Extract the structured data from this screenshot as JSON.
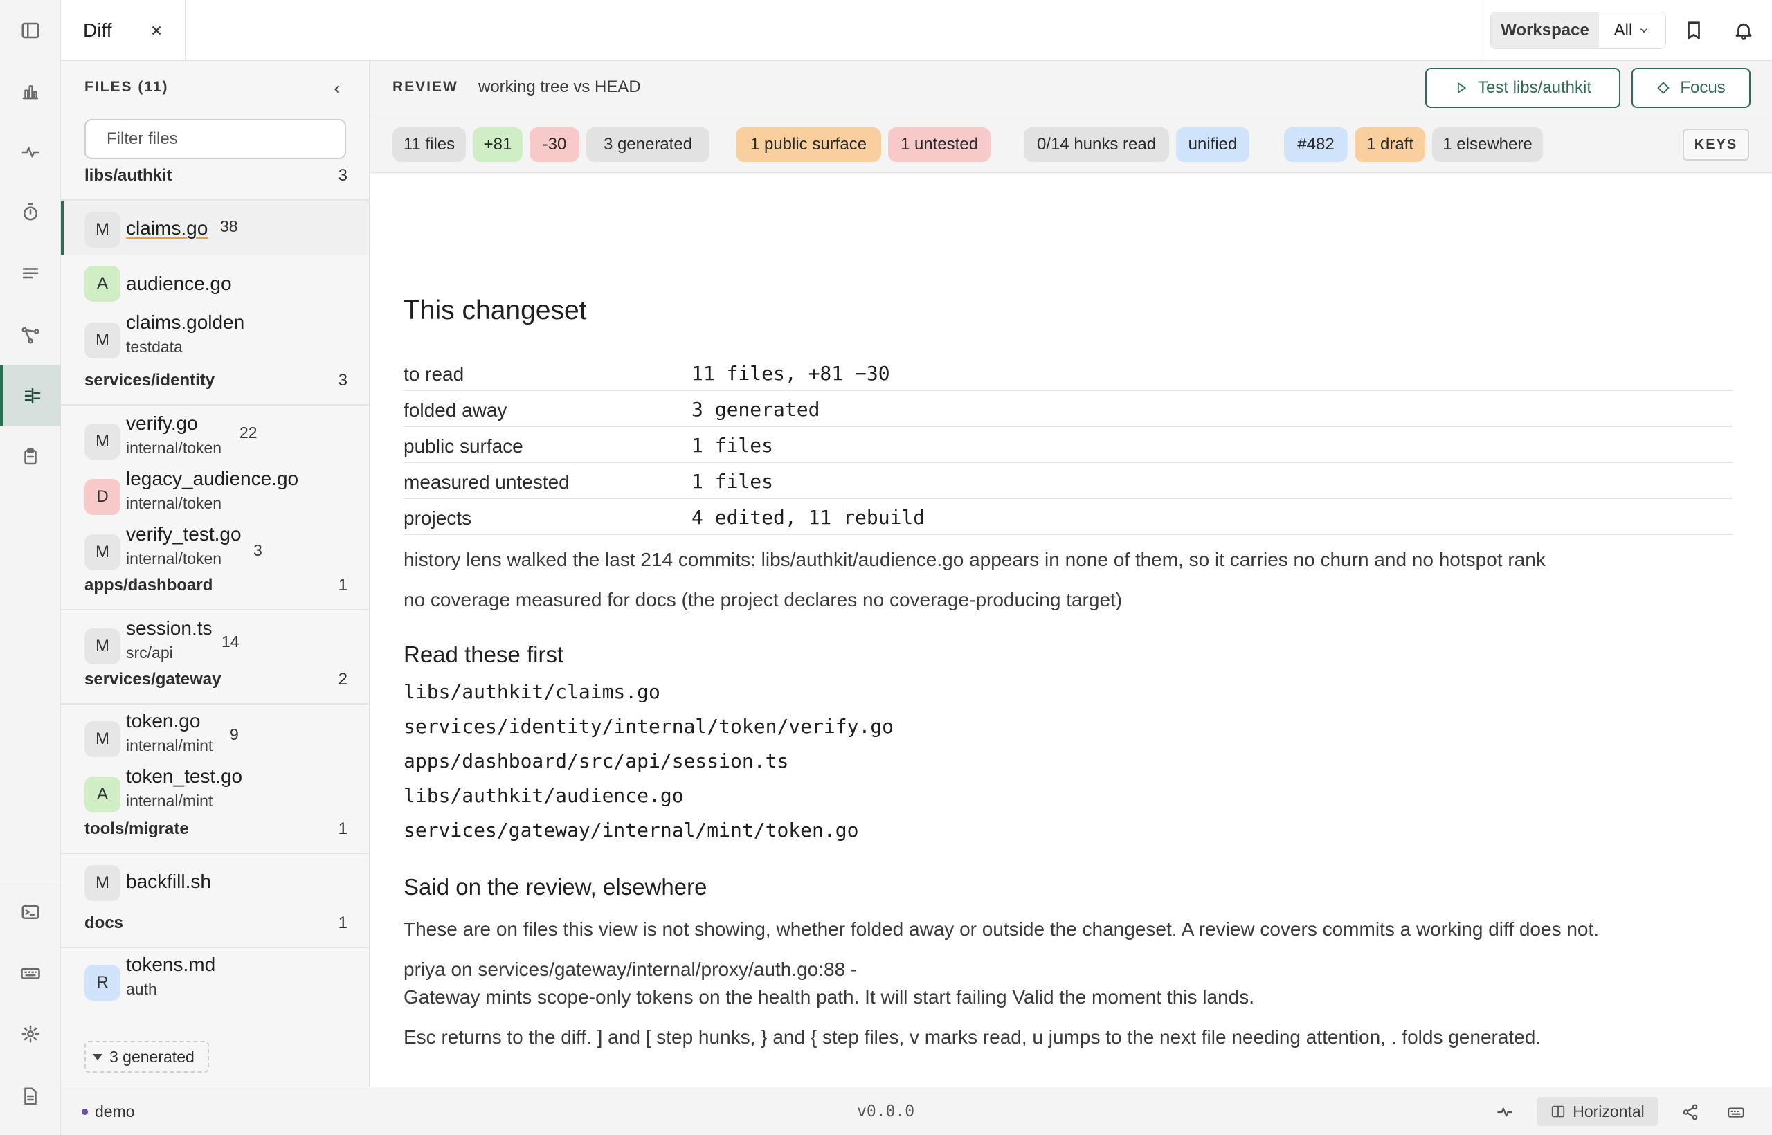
{
  "tab": {
    "label": "Diff"
  },
  "workspace": {
    "label": "Workspace",
    "value": "All"
  },
  "files": {
    "title": "FILES (11)",
    "filter_placeholder": "Filter files",
    "groups": [
      {
        "name": "libs/authkit",
        "count": "3",
        "items": [
          {
            "status": "M",
            "name": "claims.go",
            "count": "38",
            "sub": ""
          },
          {
            "status": "A",
            "name": "audience.go",
            "count": "",
            "sub": ""
          },
          {
            "status": "M",
            "name": "claims.golden",
            "count": "",
            "sub": "testdata"
          }
        ]
      },
      {
        "name": "services/identity",
        "count": "3",
        "items": [
          {
            "status": "M",
            "name": "verify.go",
            "count": "22",
            "sub": "internal/token"
          },
          {
            "status": "D",
            "name": "legacy_audience.go",
            "count": "",
            "sub": "internal/token"
          },
          {
            "status": "M",
            "name": "verify_test.go",
            "count": "3",
            "sub": "internal/token"
          }
        ]
      },
      {
        "name": "apps/dashboard",
        "count": "1",
        "items": [
          {
            "status": "M",
            "name": "session.ts",
            "count": "14",
            "sub": "src/api"
          }
        ]
      },
      {
        "name": "services/gateway",
        "count": "2",
        "items": [
          {
            "status": "M",
            "name": "token.go",
            "count": "9",
            "sub": "internal/mint"
          },
          {
            "status": "A",
            "name": "token_test.go",
            "count": "",
            "sub": "internal/mint"
          }
        ]
      },
      {
        "name": "tools/migrate",
        "count": "1",
        "items": [
          {
            "status": "M",
            "name": "backfill.sh",
            "count": "",
            "sub": ""
          }
        ]
      },
      {
        "name": "docs",
        "count": "1",
        "items": [
          {
            "status": "R",
            "name": "tokens.md",
            "count": "",
            "sub": "auth"
          }
        ]
      }
    ],
    "generated_toggle": "3 generated"
  },
  "review": {
    "label": "REVIEW",
    "description": "working tree vs HEAD",
    "test_button": "Test libs/authkit",
    "focus_button": "Focus"
  },
  "chips": {
    "files": "11 files",
    "added": "+81",
    "removed": "-30",
    "generated": "3 generated",
    "public_surface": "1 public surface",
    "untested": "1 untested",
    "hunks_read": "0/14 hunks read",
    "mode": "unified",
    "pr": "#482",
    "draft": "1 draft",
    "elsewhere": "1 elsewhere",
    "keys": "KEYS"
  },
  "changeset": {
    "title": "This changeset",
    "rows": [
      {
        "key": "to read",
        "value": "11 files, +81 −30"
      },
      {
        "key": "folded away",
        "value": "3 generated"
      },
      {
        "key": "public surface",
        "value": "1 files"
      },
      {
        "key": "measured untested",
        "value": "1 files"
      },
      {
        "key": "projects",
        "value": "4 edited, 11 rebuild"
      }
    ],
    "history_note": "history lens walked the last 214 commits: libs/authkit/audience.go appears in none of them, so it carries no churn and no hotspot rank",
    "coverage_note": "no coverage measured for docs (the project declares no coverage-producing target)",
    "read_first_title": "Read these first",
    "read_first": [
      "libs/authkit/claims.go",
      "services/identity/internal/token/verify.go",
      "apps/dashboard/src/api/session.ts",
      "libs/authkit/audience.go",
      "services/gateway/internal/mint/token.go"
    ],
    "elsewhere_title": "Said on the review, elsewhere",
    "elsewhere_note": "These are on files this view is not showing, whether folded away or outside the changeset. A review covers commits a working diff does not.",
    "comment_author_line": "priya on services/gateway/internal/proxy/auth.go:88 -",
    "comment_text": "Gateway mints scope-only tokens on the health path. It will start failing Valid the moment this lands.",
    "keys_hint": "Esc returns to the diff. ] and [ step hunks, } and { step files, v marks read, u jumps to the next file needing attention, . folds generated."
  },
  "status": {
    "workspace": "demo",
    "version": "v0.0.0",
    "layout": "Horizontal"
  }
}
